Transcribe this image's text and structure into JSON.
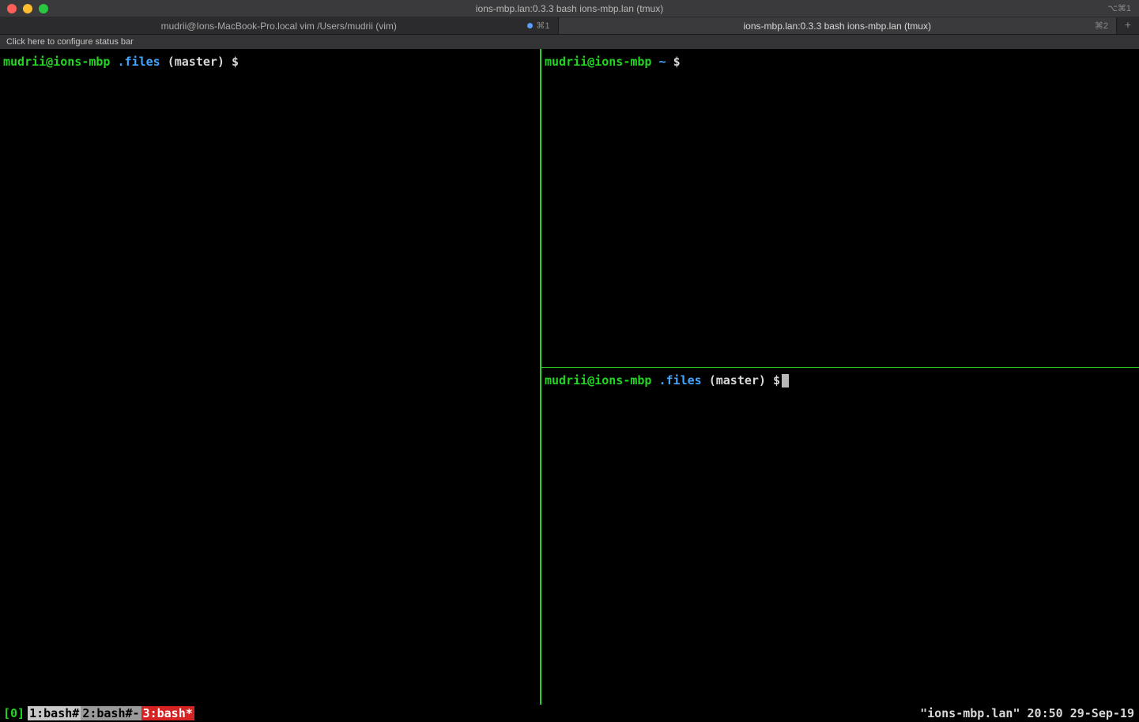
{
  "window": {
    "title": "ions-mbp.lan:0.3.3 bash ions-mbp.lan (tmux)",
    "right_indicator": "⌥⌘1"
  },
  "tabs": [
    {
      "label": "mudrii@Ions-MacBook-Pro.local vim /Users/mudrii (vim)",
      "shortcut": "⌘1",
      "modified": true,
      "active": false
    },
    {
      "label": "ions-mbp.lan:0.3.3 bash ions-mbp.lan (tmux)",
      "shortcut": "⌘2",
      "modified": false,
      "active": true
    }
  ],
  "status_hint": "Click here to configure status bar",
  "panes": {
    "left": {
      "user": "mudrii@ions-mbp",
      "path": ".files",
      "branch": "(master)",
      "dollar": "$"
    },
    "right_top": {
      "user": "mudrii@ions-mbp",
      "path": "~",
      "dollar": "$"
    },
    "right_bottom": {
      "user": "mudrii@ions-mbp",
      "path": ".files",
      "branch": "(master)",
      "dollar": "$"
    }
  },
  "tmux": {
    "session": "[0]",
    "windows": [
      {
        "label": "1:bash#",
        "style": "tmux-win-1"
      },
      {
        "label": "2:bash#-",
        "style": "tmux-win-2"
      },
      {
        "label": "3:bash*",
        "style": "tmux-win-active"
      }
    ],
    "right": "\"ions-mbp.lan\" 20:50 29-Sep-19"
  }
}
